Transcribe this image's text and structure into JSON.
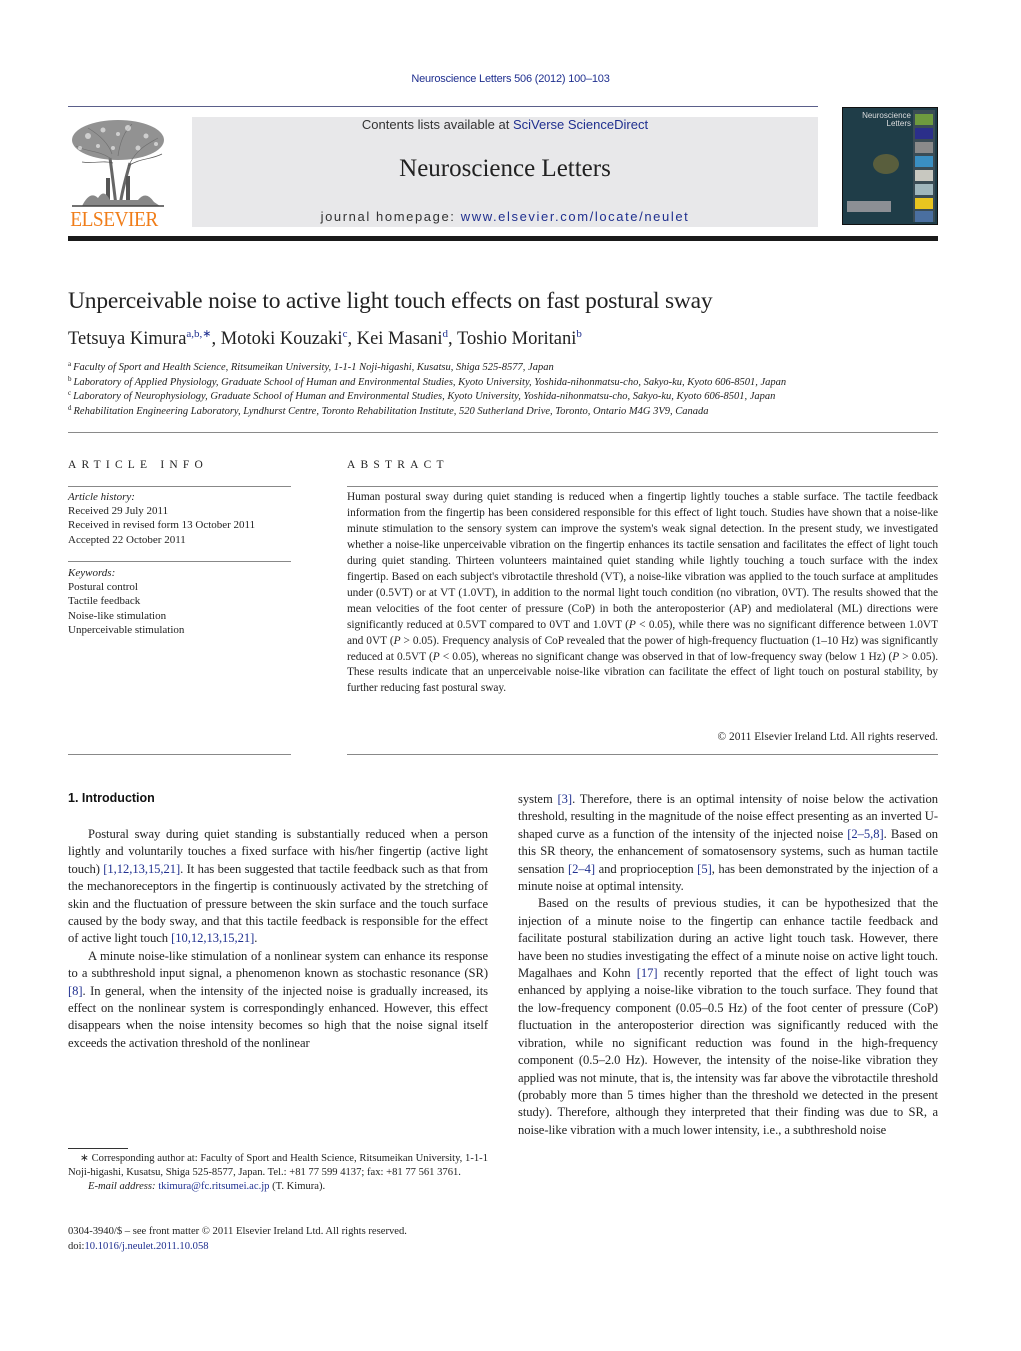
{
  "header": {
    "journal_ref": "Neuroscience Letters 506 (2012) 100–103",
    "publisher_wordmark": "ELSEVIER",
    "contents_prefix": "Contents lists available at ",
    "contents_link": "SciVerse ScienceDirect",
    "journal_title": "Neuroscience Letters",
    "homepage_prefix": "journal homepage: ",
    "homepage_link": "www.elsevier.com/locate/neulet",
    "cover_title_line1": "Neuroscience",
    "cover_title_line2": "Letters",
    "colors": {
      "link": "#1f2f8f",
      "elsevier_orange": "#f07d19",
      "masthead_bg": "#e8e8ea"
    }
  },
  "article": {
    "title": "Unperceivable noise to active light touch effects on fast postural sway",
    "authors": [
      {
        "name": "Tetsuya Kimura",
        "sup": "a,b,∗",
        "sep": ", "
      },
      {
        "name": "Motoki Kouzaki",
        "sup": "c",
        "sep": ", "
      },
      {
        "name": "Kei Masani",
        "sup": "d",
        "sep": ", "
      },
      {
        "name": "Toshio Moritani",
        "sup": "b",
        "sep": ""
      }
    ],
    "affiliations": [
      {
        "key": "a",
        "text": "Faculty of Sport and Health Science, Ritsumeikan University, 1-1-1 Noji-higashi, Kusatsu, Shiga 525-8577, Japan"
      },
      {
        "key": "b",
        "text": "Laboratory of Applied Physiology, Graduate School of Human and Environmental Studies, Kyoto University, Yoshida-nihonmatsu-cho, Sakyo-ku, Kyoto 606-8501, Japan"
      },
      {
        "key": "c",
        "text": "Laboratory of Neurophysiology, Graduate School of Human and Environmental Studies, Kyoto University, Yoshida-nihonmatsu-cho, Sakyo-ku, Kyoto 606-8501, Japan"
      },
      {
        "key": "d",
        "text": "Rehabilitation Engineering Laboratory, Lyndhurst Centre, Toronto Rehabilitation Institute, 520 Sutherland Drive, Toronto, Ontario M4G 3V9, Canada"
      }
    ]
  },
  "article_info": {
    "heading": "ARTICLE INFO",
    "history_label": "Article history:",
    "history": [
      "Received 29 July 2011",
      "Received in revised form 13 October 2011",
      "Accepted 22 October 2011"
    ],
    "keywords_label": "Keywords:",
    "keywords": [
      "Postural control",
      "Tactile feedback",
      "Noise-like stimulation",
      "Unperceivable stimulation"
    ]
  },
  "abstract": {
    "heading": "ABSTRACT",
    "segments": [
      {
        "t": "Human postural sway during quiet standing is reduced when a fingertip lightly touches a stable surface. The tactile feedback information from the fingertip has been considered responsible for this effect of light touch. Studies have shown that a noise-like minute stimulation to the sensory system can improve the system's weak signal detection. In the present study, we investigated whether a noise-like unperceivable vibration on the fingertip enhances its tactile sensation and facilitates the effect of light touch during quiet standing. Thirteen volunteers maintained quiet standing while lightly touching a touch surface with the index fingertip. Based on each subject's vibrotactile threshold (VT), a noise-like vibration was applied to the touch surface at amplitudes under (0.5VT) or at VT (1.0VT), in addition to the normal light touch condition (no vibration, 0VT). The results showed that the mean velocities of the foot center of pressure (CoP) in both the anteroposterior (AP) and mediolateral (ML) directions were significantly reduced at 0.5VT compared to 0VT and 1.0VT ("
      },
      {
        "t": "P",
        "italic": true
      },
      {
        "t": " < 0.05), while there was no significant difference between 1.0VT and 0VT ("
      },
      {
        "t": "P",
        "italic": true
      },
      {
        "t": " > 0.05). Frequency analysis of CoP revealed that the power of high-frequency fluctuation (1–10 Hz) was significantly reduced at 0.5VT ("
      },
      {
        "t": "P",
        "italic": true
      },
      {
        "t": " < 0.05), whereas no significant change was observed in that of low-frequency sway (below 1 Hz) ("
      },
      {
        "t": "P",
        "italic": true
      },
      {
        "t": " > 0.05). These results indicate that an unperceivable noise-like vibration can facilitate the effect of light touch on postural stability, by further reducing fast postural sway."
      }
    ],
    "copyright": "© 2011 Elsevier Ireland Ltd. All rights reserved."
  },
  "body": {
    "section_heading": "1.  Introduction",
    "left_paragraphs": [
      {
        "indent": true,
        "segments": [
          {
            "t": "Postural sway during quiet standing is substantially reduced when a person lightly and voluntarily touches a fixed surface with his/her fingertip (active light touch) "
          },
          {
            "t": "[1,12,13,15,21]",
            "link": true
          },
          {
            "t": ". It has been suggested that tactile feedback such as that from the mechanoreceptors in the fingertip is continuously activated by the stretching of skin and the fluctuation of pressure between the skin surface and the touch surface caused by the body sway, and that this tactile feedback is responsible for the effect of active light touch "
          },
          {
            "t": "[10,12,13,15,21]",
            "link": true
          },
          {
            "t": "."
          }
        ]
      },
      {
        "indent": true,
        "segments": [
          {
            "t": "A minute noise-like stimulation of a nonlinear system can enhance its response to a subthreshold input signal, a phenomenon known as stochastic resonance (SR) "
          },
          {
            "t": "[8]",
            "link": true
          },
          {
            "t": ". In general, when the intensity of the injected noise is gradually increased, its effect on the nonlinear system is correspondingly enhanced. However, this effect disappears when the noise intensity becomes so high that the noise signal itself exceeds the activation threshold of the nonlinear"
          }
        ]
      }
    ],
    "right_paragraphs": [
      {
        "indent": false,
        "segments": [
          {
            "t": "system "
          },
          {
            "t": "[3]",
            "link": true
          },
          {
            "t": ". Therefore, there is an optimal intensity of noise below the activation threshold, resulting in the magnitude of the noise effect presenting as an inverted U-shaped curve as a function of the intensity of the injected noise "
          },
          {
            "t": "[2–5,8]",
            "link": true
          },
          {
            "t": ". Based on this SR theory, the enhancement of somatosensory systems, such as human tactile sensation "
          },
          {
            "t": "[2–4]",
            "link": true
          },
          {
            "t": " and proprioception "
          },
          {
            "t": "[5]",
            "link": true
          },
          {
            "t": ", has been demonstrated by the injection of a minute noise at optimal intensity."
          }
        ]
      },
      {
        "indent": true,
        "segments": [
          {
            "t": "Based on the results of previous studies, it can be hypothesized that the injection of a minute noise to the fingertip can enhance tactile feedback and facilitate postural stabilization during an active light touch task. However, there have been no studies investigating the effect of a minute noise on active light touch. Magalhaes and Kohn "
          },
          {
            "t": "[17]",
            "link": true
          },
          {
            "t": " recently reported that the effect of light touch was enhanced by applying a noise-like vibration to the touch surface. They found that the low-frequency component (0.05–0.5 Hz) of the foot center of pressure (CoP) fluctuation in the anteroposterior direction was significantly reduced with the vibration, while no significant reduction was found in the high-frequency component (0.5–2.0 Hz). However, the intensity of the noise-like vibration they applied was not minute, that is, the intensity was far above the vibrotactile threshold (probably more than 5 times higher than the threshold we detected in the present study). Therefore, although they interpreted that their finding was due to SR, a noise-like vibration with a much lower intensity, i.e., a subthreshold noise"
          }
        ]
      }
    ]
  },
  "footnote": {
    "corresponding": "∗  Corresponding author at: Faculty of Sport and Health Science, Ritsumeikan University, 1-1-1 Noji-higashi, Kusatsu, Shiga 525-8577, Japan. Tel.: +81 77 599 4137; fax: +81 77 561 3761.",
    "email_label": "E-mail address: ",
    "email": "tkimura@fc.ritsumei.ac.jp",
    "email_suffix": " (T. Kimura).",
    "frontmatter": "0304-3940/$ – see front matter © 2011 Elsevier Ireland Ltd. All rights reserved.",
    "doi_prefix": "doi:",
    "doi": "10.1016/j.neulet.2011.10.058"
  }
}
